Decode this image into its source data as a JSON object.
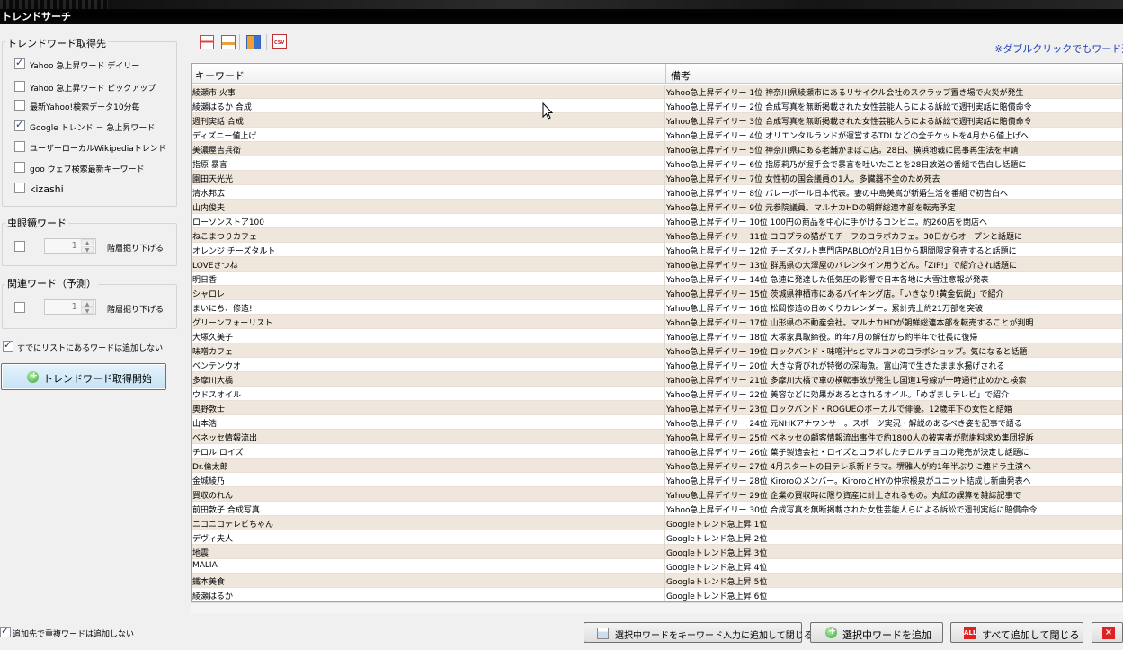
{
  "window": {
    "title": "トレンドサーチ"
  },
  "sources": {
    "title": "トレンドワード取得先",
    "items": [
      {
        "label": "Yahoo 急上昇ワード デイリー",
        "checked": true
      },
      {
        "label": "Yahoo 急上昇ワード ピックアップ",
        "checked": false
      },
      {
        "label": "最新Yahoo!検索データ10分毎",
        "checked": false
      },
      {
        "label": "Google トレンド － 急上昇ワード",
        "checked": true
      },
      {
        "label": "ユーザーローカルWikipediaトレンド",
        "checked": false
      },
      {
        "label": "goo ウェブ検索最新キーワード",
        "checked": false
      },
      {
        "label": "kizashi",
        "checked": false
      }
    ]
  },
  "lens": {
    "title": "虫眼鏡ワード",
    "value": "1",
    "label": "階層掘り下げる",
    "checked": false
  },
  "related": {
    "title": "関連ワード（予測）",
    "value": "1",
    "label": "階層掘り下げる",
    "checked": false
  },
  "skip_existing": {
    "label": "すでにリストにあるワードは追加しない",
    "checked": true
  },
  "start_button": {
    "label": "トレンドワード取得開始"
  },
  "toolbar": {
    "hint": "※ダブルクリックでもワード追加"
  },
  "table": {
    "columns": [
      "キーワード",
      "備考"
    ],
    "rows": [
      [
        "綾瀬市 火事",
        "Yahoo急上昇デイリー 1位 神奈川県綾瀬市にあるリサイクル会社のスクラップ置き場で火災が発生"
      ],
      [
        "綾瀬はるか 合成",
        "Yahoo急上昇デイリー 2位 合成写真を無断掲載された女性芸能人らによる訴訟で週刊実話に賠償命令"
      ],
      [
        "週刊実話 合成",
        "Yahoo急上昇デイリー 3位 合成写真を無断掲載された女性芸能人らによる訴訟で週刊実話に賠償命令"
      ],
      [
        "ディズニー値上げ",
        "Yahoo急上昇デイリー 4位 オリエンタルランドが運営するTDLなどの全チケットを4月から値上げへ"
      ],
      [
        "美濃屋吉兵衛",
        "Yahoo急上昇デイリー 5位 神奈川県にある老舗かまぼこ店。28日、横浜地裁に民事再生法を申請"
      ],
      [
        "指原 暴言",
        "Yahoo急上昇デイリー 6位 指原莉乃が握手会で暴言を吐いたことを28日放送の番組で告白し話題に"
      ],
      [
        "園田天光光",
        "Yahoo急上昇デイリー 7位 女性初の国会議員の1人。多臓器不全のため死去"
      ],
      [
        "清水邦広",
        "Yahoo急上昇デイリー 8位 バレーボール日本代表。妻の中島美嵩が新婚生活を番組で初告白へ"
      ],
      [
        "山内俊夫",
        "Yahoo急上昇デイリー 9位 元参院議員。マルナカHDの朝鮮総連本部を転売予定"
      ],
      [
        "ローソンストア100",
        "Yahoo急上昇デイリー 10位 100円の商品を中心に手がけるコンビニ。約260店を閉店へ"
      ],
      [
        "ねこまつりカフェ",
        "Yahoo急上昇デイリー 11位 コロプラの猫がモチーフのコラボカフェ。30日からオープンと話題に"
      ],
      [
        "オレンジ チーズタルト",
        "Yahoo急上昇デイリー 12位 チーズタルト専門店PABLOが2月1日から期間限定発売すると話題に"
      ],
      [
        "LOVEきつね",
        "Yahoo急上昇デイリー 13位 群馬県の大澤屋のバレンタイン用うどん。「ZIP!」で紹介され話題に"
      ],
      [
        "明日香",
        "Yahoo急上昇デイリー 14位 急速に発達した低気圧の影響で日本各地に大雪注意報が発表"
      ],
      [
        "シャロレ",
        "Yahoo急上昇デイリー 15位 茨城県神栖市にあるバイキング店。「いきなり!黄金伝説」で紹介"
      ],
      [
        "まいにち、修造!",
        "Yahoo急上昇デイリー 16位 松岡修造の日めくりカレンダー。累計売上約21万部を突破"
      ],
      [
        "グリーンフォーリスト",
        "Yahoo急上昇デイリー 17位 山形県の不動産会社。マルナカHDが朝鮮総連本部を転売することが判明"
      ],
      [
        "大塚久美子",
        "Yahoo急上昇デイリー 18位 大塚家具取締役。昨年7月の解任から約半年で社長に復帰"
      ],
      [
        "味噌カフェ",
        "Yahoo急上昇デイリー 19位 ロックバンド・味噌汁'sとマルコメのコラボショップ。気になると話題"
      ],
      [
        "ベンテンウオ",
        "Yahoo急上昇デイリー 20位 大きな背びれが特徴の深海魚。富山湾で生きたまま水揚げされる"
      ],
      [
        "多摩川大橋",
        "Yahoo急上昇デイリー 21位 多摩川大橋で車の横転事故が発生し国道1号線が一時通行止めかと検索"
      ],
      [
        "ウドスオイル",
        "Yahoo急上昇デイリー 22位 美容などに効果があるとされるオイル。「めざましテレビ」で紹介"
      ],
      [
        "奥野敦士",
        "Yahoo急上昇デイリー 23位 ロックバンド・ROGUEのボーカルで俳優。12歳年下の女性と結婚"
      ],
      [
        "山本浩",
        "Yahoo急上昇デイリー 24位 元NHKアナウンサー。スポーツ実況・解説のあるべき姿を記事で語る"
      ],
      [
        "ベネッセ情報流出",
        "Yahoo急上昇デイリー 25位 ベネッセの顧客情報流出事件で約1800人の被害者が慰謝料求め集団提訴"
      ],
      [
        "チロル ロイズ",
        "Yahoo急上昇デイリー 26位 菓子製造会社・ロイズとコラボしたチロルチョコの発売が決定し話題に"
      ],
      [
        "Dr.倫太郎",
        "Yahoo急上昇デイリー 27位 4月スタートの日テレ系新ドラマ。堺雅人が約1年半ぶりに連ドラ主演へ"
      ],
      [
        "金城綾乃",
        "Yahoo急上昇デイリー 28位 Kiroroのメンバー。KiroroとHYの仲宗根泉がユニット結成し新曲発表へ"
      ],
      [
        "買収のれん",
        "Yahoo急上昇デイリー 29位 企業の買収時に限り資産に計上されるもの。丸紅の誤算を雑誌記事で"
      ],
      [
        "前田敦子 合成写真",
        "Yahoo急上昇デイリー 30位 合成写真を無断掲載された女性芸能人らによる訴訟で週刊実話に賠償命令"
      ],
      [
        "ニコニコテレビちゃん",
        "Googleトレンド急上昇 1位"
      ],
      [
        "デヴィ夫人",
        "Googleトレンド急上昇 2位"
      ],
      [
        "地震",
        "Googleトレンド急上昇 3位"
      ],
      [
        "MALIA",
        "Googleトレンド急上昇 4位"
      ],
      [
        "鐵本美食",
        "Googleトレンド急上昇 5位"
      ],
      [
        "綾瀬はるか",
        "Googleトレンド急上昇 6位"
      ]
    ]
  },
  "footer": {
    "no_dup_label": "追加先で重複ワードは追加しない",
    "no_dup_checked": true,
    "btn_add_to_input": "選択中ワードをキーワード入力に追加して閉じる",
    "btn_add_selected": "選択中ワードを追加",
    "btn_add_all": "すべて追加して閉じる"
  },
  "colors": {
    "row_alt": "#efe6dc",
    "hint": "#1f3fb8",
    "titlebar": "#000000"
  }
}
